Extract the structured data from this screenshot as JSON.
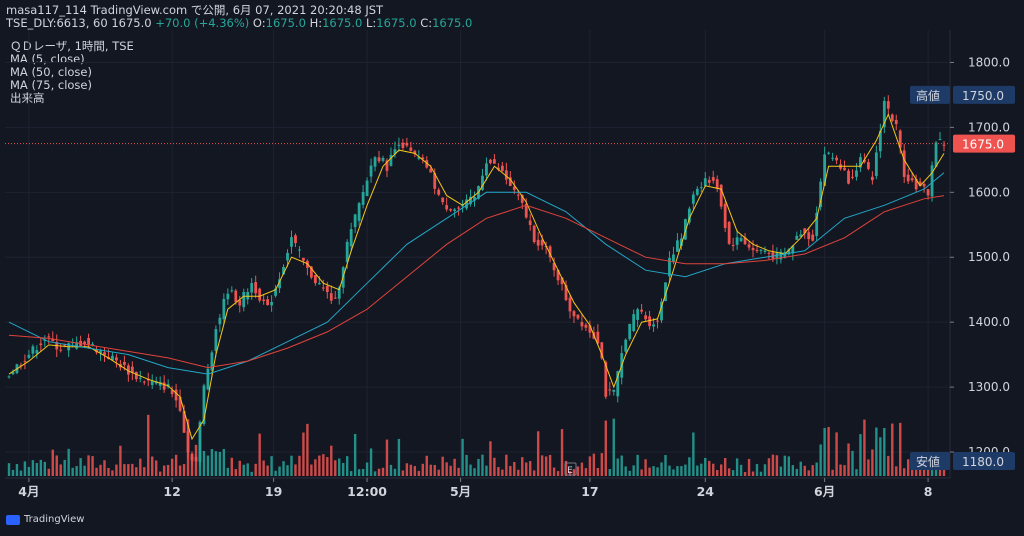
{
  "header": {
    "line1": "masa117_114 TradingView.com で公開, 6月 07, 2021 20:20:48 JST",
    "line2_prefix": "TSE_DLY:6613, 60 1675.0",
    "change": "+70.0 (+4.36%)",
    "ohlc_o_label": "O:",
    "ohlc_o": "1675.0",
    "ohlc_h_label": "H:",
    "ohlc_h": "1675.0",
    "ohlc_l_label": "L:",
    "ohlc_l": "1675.0",
    "ohlc_c_label": "C:",
    "ohlc_c": "1675.0"
  },
  "legend": {
    "symbol": "ＱＤレーザ, 1時間, TSE",
    "ma5": "MA (5, close)",
    "ma50": "MA (50, close)",
    "ma75": "MA (75, close)",
    "volume": "出来高"
  },
  "price_tags": {
    "high_label": "高値",
    "high_value": "1750.0",
    "last_value": "1675.0",
    "low_label": "安値",
    "low_value": "1180.0"
  },
  "branding": "TradingView",
  "event_marker": "E",
  "colors": {
    "background": "#131722",
    "up": "#26a69a",
    "down": "#ef5350",
    "ma5": "#f5c518",
    "ma50": "#22a7c7",
    "ma75": "#e0433a",
    "tag": "#1e3a66"
  },
  "chart_data": {
    "type": "candlestick",
    "ylim": [
      1160,
      1850
    ],
    "y_ticks": [
      "1800.0",
      "1700.0",
      "1600.0",
      "1500.0",
      "1400.0",
      "1300.0",
      "1200.0"
    ],
    "x_ticks": [
      "4月",
      "12",
      "19",
      "12:00",
      "5月",
      "17",
      "24",
      "6月",
      "8"
    ],
    "close_path": [
      [
        0,
        1320
      ],
      [
        8,
        1345
      ],
      [
        18,
        1375
      ],
      [
        26,
        1360
      ],
      [
        38,
        1370
      ],
      [
        46,
        1355
      ],
      [
        54,
        1340
      ],
      [
        62,
        1320
      ],
      [
        68,
        1310
      ],
      [
        74,
        1305
      ],
      [
        80,
        1300
      ],
      [
        86,
        1270
      ],
      [
        90,
        1200
      ],
      [
        94,
        1185
      ],
      [
        98,
        1300
      ],
      [
        104,
        1390
      ],
      [
        110,
        1450
      ],
      [
        116,
        1430
      ],
      [
        122,
        1460
      ],
      [
        130,
        1420
      ],
      [
        136,
        1470
      ],
      [
        142,
        1530
      ],
      [
        150,
        1480
      ],
      [
        158,
        1450
      ],
      [
        164,
        1430
      ],
      [
        170,
        1520
      ],
      [
        178,
        1600
      ],
      [
        184,
        1660
      ],
      [
        190,
        1640
      ],
      [
        196,
        1680
      ],
      [
        202,
        1660
      ],
      [
        210,
        1640
      ],
      [
        218,
        1580
      ],
      [
        226,
        1575
      ],
      [
        234,
        1590
      ],
      [
        240,
        1650
      ],
      [
        248,
        1630
      ],
      [
        254,
        1600
      ],
      [
        258,
        1580
      ],
      [
        264,
        1530
      ],
      [
        270,
        1510
      ],
      [
        276,
        1470
      ],
      [
        282,
        1420
      ],
      [
        288,
        1400
      ],
      [
        294,
        1380
      ],
      [
        297,
        1370
      ],
      [
        300,
        1290
      ],
      [
        304,
        1290
      ],
      [
        310,
        1380
      ],
      [
        316,
        1420
      ],
      [
        322,
        1400
      ],
      [
        326,
        1400
      ],
      [
        332,
        1500
      ],
      [
        338,
        1530
      ],
      [
        344,
        1600
      ],
      [
        350,
        1620
      ],
      [
        356,
        1610
      ],
      [
        362,
        1520
      ],
      [
        368,
        1530
      ],
      [
        374,
        1510
      ],
      [
        380,
        1510
      ],
      [
        386,
        1500
      ],
      [
        392,
        1510
      ],
      [
        398,
        1540
      ],
      [
        404,
        1530
      ],
      [
        410,
        1660
      ],
      [
        416,
        1650
      ],
      [
        422,
        1620
      ],
      [
        428,
        1650
      ],
      [
        434,
        1620
      ],
      [
        440,
        1740
      ],
      [
        446,
        1700
      ],
      [
        450,
        1630
      ],
      [
        456,
        1610
      ],
      [
        462,
        1600
      ],
      [
        466,
        1680
      ],
      [
        470,
        1675
      ]
    ],
    "series": [
      {
        "name": "MA (5, close)",
        "values": [
          [
            0,
            1320
          ],
          [
            10,
            1340
          ],
          [
            20,
            1365
          ],
          [
            30,
            1362
          ],
          [
            40,
            1362
          ],
          [
            50,
            1345
          ],
          [
            60,
            1325
          ],
          [
            70,
            1312
          ],
          [
            80,
            1302
          ],
          [
            86,
            1285
          ],
          [
            92,
            1220
          ],
          [
            98,
            1250
          ],
          [
            104,
            1350
          ],
          [
            110,
            1420
          ],
          [
            118,
            1440
          ],
          [
            126,
            1440
          ],
          [
            134,
            1450
          ],
          [
            142,
            1500
          ],
          [
            150,
            1490
          ],
          [
            158,
            1460
          ],
          [
            166,
            1450
          ],
          [
            172,
            1510
          ],
          [
            180,
            1580
          ],
          [
            188,
            1640
          ],
          [
            196,
            1665
          ],
          [
            204,
            1660
          ],
          [
            212,
            1640
          ],
          [
            220,
            1595
          ],
          [
            228,
            1580
          ],
          [
            236,
            1600
          ],
          [
            244,
            1640
          ],
          [
            252,
            1620
          ],
          [
            260,
            1585
          ],
          [
            268,
            1530
          ],
          [
            276,
            1480
          ],
          [
            284,
            1430
          ],
          [
            292,
            1395
          ],
          [
            298,
            1350
          ],
          [
            304,
            1300
          ],
          [
            310,
            1350
          ],
          [
            318,
            1400
          ],
          [
            326,
            1405
          ],
          [
            334,
            1480
          ],
          [
            342,
            1560
          ],
          [
            350,
            1610
          ],
          [
            358,
            1605
          ],
          [
            366,
            1540
          ],
          [
            374,
            1520
          ],
          [
            382,
            1510
          ],
          [
            390,
            1505
          ],
          [
            398,
            1530
          ],
          [
            406,
            1560
          ],
          [
            412,
            1640
          ],
          [
            420,
            1640
          ],
          [
            428,
            1640
          ],
          [
            436,
            1680
          ],
          [
            442,
            1720
          ],
          [
            450,
            1650
          ],
          [
            458,
            1610
          ],
          [
            464,
            1630
          ],
          [
            470,
            1660
          ]
        ]
      },
      {
        "name": "MA (50, close)",
        "values": [
          [
            0,
            1400
          ],
          [
            20,
            1370
          ],
          [
            40,
            1360
          ],
          [
            60,
            1350
          ],
          [
            80,
            1330
          ],
          [
            100,
            1320
          ],
          [
            120,
            1340
          ],
          [
            140,
            1370
          ],
          [
            160,
            1400
          ],
          [
            180,
            1460
          ],
          [
            200,
            1520
          ],
          [
            220,
            1560
          ],
          [
            240,
            1600
          ],
          [
            260,
            1600
          ],
          [
            280,
            1570
          ],
          [
            300,
            1520
          ],
          [
            320,
            1480
          ],
          [
            340,
            1470
          ],
          [
            360,
            1490
          ],
          [
            380,
            1500
          ],
          [
            400,
            1510
          ],
          [
            420,
            1560
          ],
          [
            440,
            1580
          ],
          [
            460,
            1605
          ],
          [
            470,
            1630
          ]
        ]
      },
      {
        "name": "MA (75, close)",
        "values": [
          [
            0,
            1380
          ],
          [
            20,
            1375
          ],
          [
            40,
            1365
          ],
          [
            60,
            1355
          ],
          [
            80,
            1345
          ],
          [
            100,
            1330
          ],
          [
            120,
            1340
          ],
          [
            140,
            1360
          ],
          [
            160,
            1385
          ],
          [
            180,
            1420
          ],
          [
            200,
            1470
          ],
          [
            220,
            1520
          ],
          [
            240,
            1560
          ],
          [
            260,
            1580
          ],
          [
            280,
            1560
          ],
          [
            300,
            1530
          ],
          [
            320,
            1500
          ],
          [
            340,
            1490
          ],
          [
            360,
            1490
          ],
          [
            380,
            1495
          ],
          [
            400,
            1505
          ],
          [
            420,
            1530
          ],
          [
            440,
            1570
          ],
          [
            460,
            1590
          ],
          [
            470,
            1595
          ]
        ]
      }
    ]
  }
}
